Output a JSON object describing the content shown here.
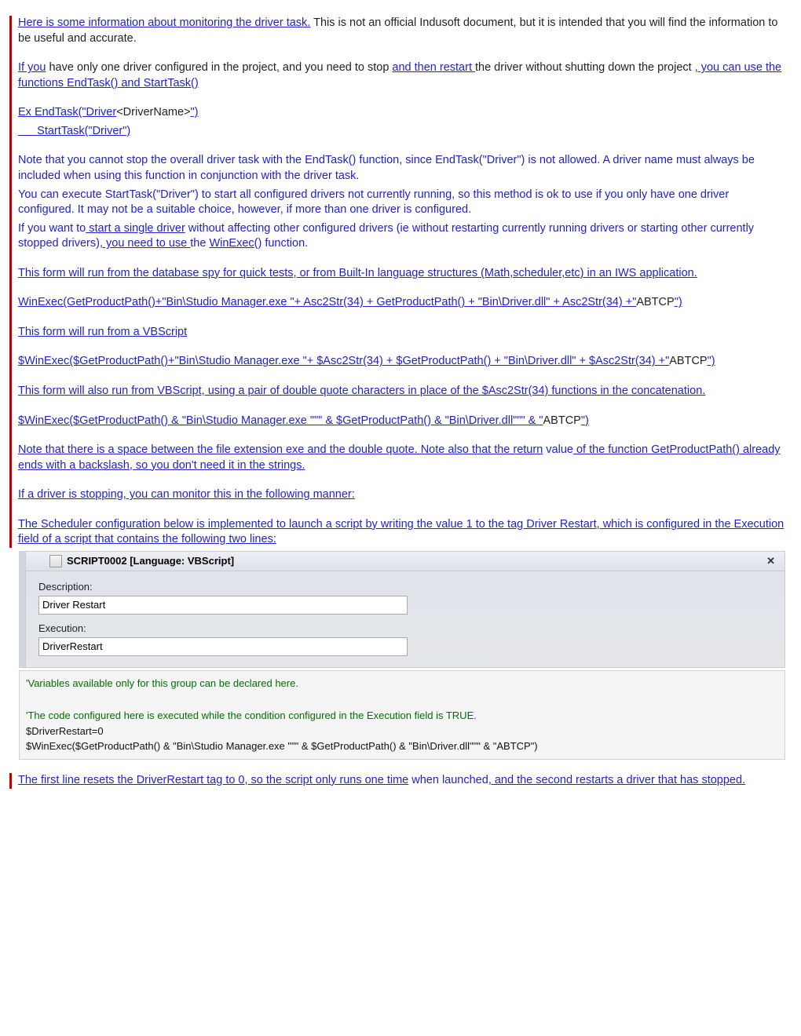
{
  "p1": {
    "s1": "Here is some information about monitoring the driver task.",
    "s2": " This is not an official Indusoft document, but it is intended that you will find the information to be useful and accurate."
  },
  "p2": {
    "s1": "If you",
    "s2": " have only one driver configured in the project",
    "s3": ",",
    "s4": " and you need to stop ",
    "s5": "and then restart ",
    "s6": "the driver without shutting down the project ",
    "s7": ", you can use the functions EndTask() and StartTask()"
  },
  "p3": {
    "s1": "Ex  EndTask(\"Driver",
    "s2": "<DriverName>",
    "s3": "\")"
  },
  "p4": "      StartTask(\"Driver\")",
  "p5": "Note that you cannot stop the overall driver task with the EndTask() function, since EndTask(\"Driver\") is not allowed. A driver name must always be included when using this function in conjunction with the driver task.",
  "p6": "You can execute StartTask(\"Driver\") to start all configured drivers not currently running, so this method is ok to use if you only have one driver configured. It may not be a suitable choice, however, if more than one driver is configured.",
  "p7": {
    "s1": "If you want to",
    "s2": " start a single driver",
    "s3": " without affecting other configured drivers (ie without restarting currently running drivers or starting other currently stopped drivers)",
    "s4": ", you need to use ",
    "s5": "the ",
    "s6": "WinExec",
    "s7": "() function."
  },
  "p8": "This form will run from the database spy for quick tests, or from Built-In language structures (Math,scheduler,etc) in an IWS application.",
  "p9": {
    "s1": "WinExec(GetProductPath()+\"Bin\\Studio Manager.exe \"+ Asc2Str(34) + GetProductPath() + \"Bin\\Driver.dll\" + Asc2Str(34) +\"",
    "s2": "ABTCP",
    "s3": "\")"
  },
  "p10": "This form will run from a VBScript",
  "p11": {
    "s1": "$WinExec($GetProductPath()+\"Bin\\Studio Manager.exe \"+ $Asc2Str(34) + $GetProductPath() + \"Bin\\Driver.dll\" + $Asc2Str(34) +\"",
    "s2": "ABTCP",
    "s3": "\")"
  },
  "p12": "This form will also run from VBScript, using a pair of double quote characters in place of the $Asc2Str(34) functions in the concatenation.",
  "p13": {
    "s1": "$WinExec($GetProductPath() & \"Bin\\Studio Manager.exe \"\"\" & $GetProductPath() & \"Bin\\Driver.dll\"\"\" & \"",
    "s2": "ABTCP",
    "s3": "\")"
  },
  "p14": {
    "s1": "Note that there is a space between the file extension exe and the double quote. Note also that the return",
    "s2": " value",
    "s3": " of the function GetProductPath() already ends with a backslash, so you don't need it in the strings."
  },
  "p15": "If a driver is stopping, you can monitor this in the following manner:",
  "p16": "The Scheduler configuration below is implemented to launch a script by writing the value 1 to the tag Driver Restart, which is configured in the Execution field of a script that contains the following two lines:",
  "ui1": {
    "tabTitle": "SCRIPT0002 [Language: VBScript]",
    "descLabel": "Description:",
    "descVal": "Driver Restart",
    "execLabel": "Execution:",
    "execVal": "DriverRestart"
  },
  "code1": {
    "l1": "'Variables available only for this group can be declared here.",
    "l2": "'The code configured here is executed while the condition configured in the Execution field is TRUE.",
    "l3": "$DriverRestart=0",
    "l4": "$WinExec($GetProductPath() & \"Bin\\Studio Manager.exe \"\"\" & $GetProductPath() & \"Bin\\Driver.dll\"\"\" & \"ABTCP\")"
  },
  "p17": {
    "s1": "The first line resets the DriverRestart tag to 0, so the script only runs one time",
    "s2": " when launched",
    "s3": ", and the second restarts a drive",
    "s4": "r that has stopped."
  }
}
